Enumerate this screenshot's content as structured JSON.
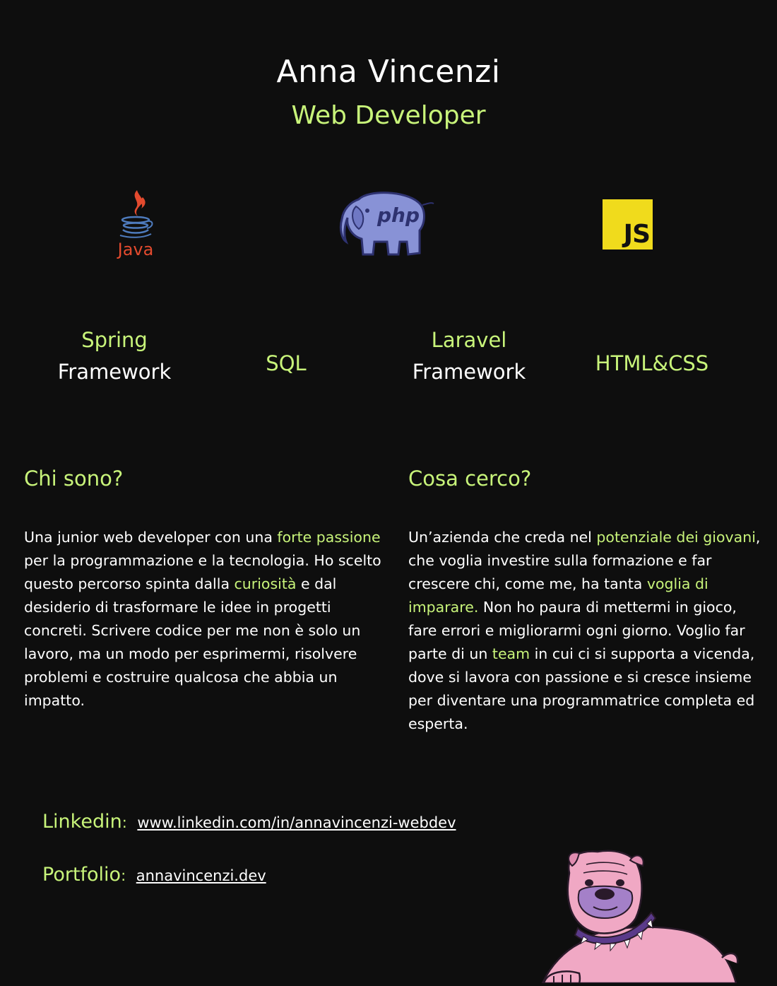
{
  "header": {
    "name": "Anna Vincenzi",
    "role": "Web Developer"
  },
  "logos": [
    {
      "icon": "java-logo",
      "label": "Java"
    },
    {
      "icon": "php-logo",
      "label": "php"
    },
    {
      "icon": "javascript-logo",
      "label": "JS"
    }
  ],
  "skills": {
    "spring": {
      "line1": "Spring",
      "line2": "Framework"
    },
    "sql": {
      "label": "SQL"
    },
    "laravel": {
      "line1": "Laravel",
      "line2": "Framework"
    },
    "html": {
      "label": "HTML&CSS"
    }
  },
  "about": {
    "title": "Chi sono?",
    "parts": [
      "Una junior web developer con una ",
      "forte passione",
      " per la programmazione e la tecnologia. Ho scelto questo percorso spinta dalla ",
      "curiosità",
      " e dal desiderio di trasformare le idee in progetti concreti. Scrivere codice per me non è solo un lavoro, ma un modo per esprimermi, risolvere problemi e costruire qualcosa che abbia un impatto."
    ]
  },
  "seeking": {
    "title": "Cosa cerco?",
    "parts": [
      "Un’azienda che creda nel ",
      "potenziale dei giovani",
      ", che voglia investire sulla formazione e far crescere chi, come me, ha tanta ",
      "voglia di imparare.",
      " Non ho paura di mettermi in gioco, fare errori e migliorarmi ogni giorno. Voglio far parte di un ",
      "team",
      " in cui ci si supporta a vicenda, dove si lavora con passione e si cresce insieme per diventare una programmatrice completa ed esperta."
    ]
  },
  "contacts": {
    "linkedin_label": "Linkedin",
    "linkedin_sep": ":",
    "linkedin_url": "www.linkedin.com/in/annavincenzi-webdev",
    "portfolio_label": "Portfolio",
    "portfolio_sep": ":",
    "portfolio_url": "annavincenzi.dev"
  },
  "colors": {
    "background": "#0e0e0e",
    "accent": "#c8f47a",
    "text": "#ffffff",
    "js_yellow": "#f0db1c"
  },
  "decoration": {
    "icon": "bulldog-illustration"
  }
}
